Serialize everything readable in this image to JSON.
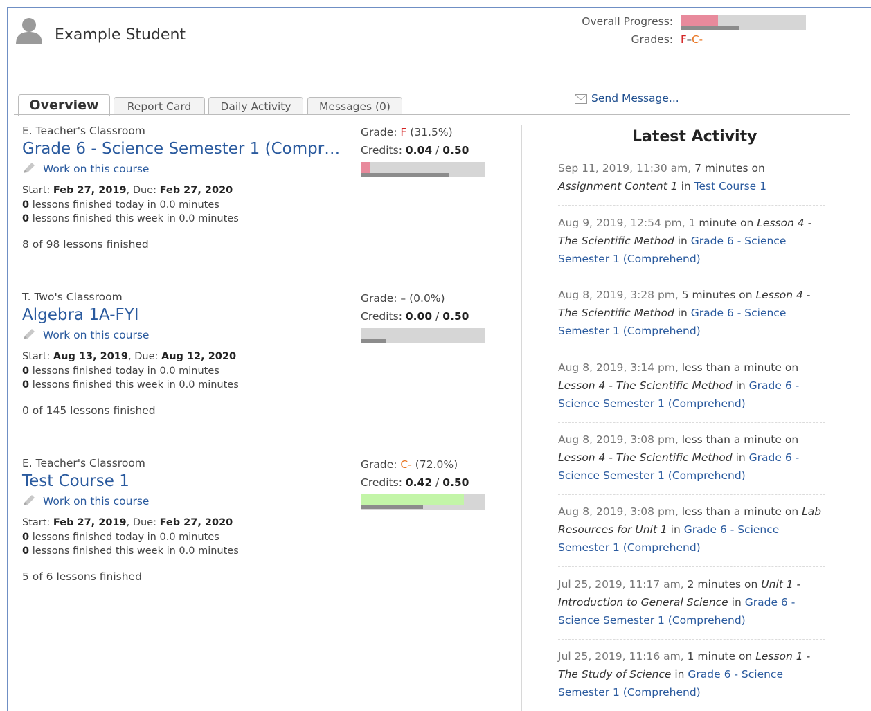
{
  "student": {
    "name": "Example Student",
    "avatar_icon": "person-silhouette-icon"
  },
  "summary": {
    "overall_progress_label": "Overall Progress:",
    "overall_progress": 0.3,
    "overall_time": 0.47,
    "grades_label": "Grades:",
    "grades": [
      {
        "text": "F",
        "color": "#d42424"
      },
      {
        "text": "C-",
        "color": "#e8731f"
      }
    ],
    "grades_separator": "–"
  },
  "tabs": [
    {
      "label": "Overview",
      "active": true
    },
    {
      "label": "Report Card",
      "active": false
    },
    {
      "label": "Daily Activity",
      "active": false
    },
    {
      "label": "Messages (0)",
      "active": false
    }
  ],
  "send_message": {
    "label": "Send Message...",
    "icon": "envelope-icon"
  },
  "courses": [
    {
      "classroom": "E. Teacher's Classroom",
      "title": "Grade 6 - Science Semester 1 (Compr…",
      "work_link": "Work on this course",
      "start_label": "Start:",
      "start": "Feb 27, 2019",
      "due_label": "Due:",
      "due": "Feb 27, 2020",
      "today_count": "0",
      "today_text": "lessons finished today in 0.0 minutes",
      "week_count": "0",
      "week_text": "lessons finished this week in 0.0 minutes",
      "finished": "8 of 98 lessons finished",
      "grade_label": "Grade:",
      "grade": "F",
      "grade_color": "#d42424",
      "grade_pct": "(31.5%)",
      "credits_label": "Credits:",
      "credits_earned": "0.04",
      "credits_total": "0.50",
      "progress": 0.08,
      "time_progress": 0.71,
      "fill_color": "#e88a9c"
    },
    {
      "classroom": "T. Two's Classroom",
      "title": "Algebra 1A-FYI",
      "work_link": "Work on this course",
      "start_label": "Start:",
      "start": "Aug 13, 2019",
      "due_label": "Due:",
      "due": "Aug 12, 2020",
      "today_count": "0",
      "today_text": "lessons finished today in 0.0 minutes",
      "week_count": "0",
      "week_text": "lessons finished this week in 0.0 minutes",
      "finished": "0 of 145 lessons finished",
      "grade_label": "Grade:",
      "grade": "–",
      "grade_color": "#444444",
      "grade_pct": "(0.0%)",
      "credits_label": "Credits:",
      "credits_earned": "0.00",
      "credits_total": "0.50",
      "progress": 0.0,
      "time_progress": 0.2,
      "fill_color": "#e88a9c"
    },
    {
      "classroom": "E. Teacher's Classroom",
      "title": "Test Course 1",
      "work_link": "Work on this course",
      "start_label": "Start:",
      "start": "Feb 27, 2019",
      "due_label": "Due:",
      "due": "Feb 27, 2020",
      "today_count": "0",
      "today_text": "lessons finished today in 0.0 minutes",
      "week_count": "0",
      "week_text": "lessons finished this week in 0.0 minutes",
      "finished": "5 of 6 lessons finished",
      "grade_label": "Grade:",
      "grade": "C-",
      "grade_color": "#e8731f",
      "grade_pct": "(72.0%)",
      "credits_label": "Credits:",
      "credits_earned": "0.42",
      "credits_total": "0.50",
      "progress": 0.83,
      "time_progress": 0.5,
      "fill_color": "#c3f5a8"
    }
  ],
  "latest_activity": {
    "title": "Latest Activity",
    "items": [
      {
        "time": "Sep 11, 2019, 11:30 am,",
        "duration": "7 minutes on",
        "item": "Assignment Content 1",
        "in": "in",
        "course": "Test Course 1"
      },
      {
        "time": "Aug 9, 2019, 12:54 pm,",
        "duration": "1 minute on",
        "item": "Lesson 4 - The Scientific Method",
        "in": "in",
        "course": "Grade 6 - Science Semester 1 (Comprehend)"
      },
      {
        "time": "Aug 8, 2019, 3:28 pm,",
        "duration": "5 minutes on",
        "item": "Lesson 4 - The Scientific Method",
        "in": "in",
        "course": "Grade 6 - Science Semester 1 (Comprehend)"
      },
      {
        "time": "Aug 8, 2019, 3:14 pm,",
        "duration": "less than a minute on",
        "item": "Lesson 4 - The Scientific Method",
        "in": "in",
        "course": "Grade 6 - Science Semester 1 (Comprehend)"
      },
      {
        "time": "Aug 8, 2019, 3:08 pm,",
        "duration": "less than a minute on",
        "item": "Lesson 4 - The Scientific Method",
        "in": "in",
        "course": "Grade 6 - Science Semester 1 (Comprehend)"
      },
      {
        "time": "Aug 8, 2019, 3:08 pm,",
        "duration": "less than a minute on",
        "item": "Lab Resources for Unit 1",
        "in": "in",
        "course": "Grade 6 - Science Semester 1 (Comprehend)"
      },
      {
        "time": "Jul 25, 2019, 11:17 am,",
        "duration": "2 minutes on",
        "item": "Unit 1 - Introduction to General Science",
        "in": "in",
        "course": "Grade 6 - Science Semester 1 (Comprehend)"
      },
      {
        "time": "Jul 25, 2019, 11:16 am,",
        "duration": "1 minute on",
        "item": "Lesson 1 - The Study of Science",
        "in": "in",
        "course": "Grade 6 - Science Semester 1 (Comprehend)"
      }
    ]
  }
}
